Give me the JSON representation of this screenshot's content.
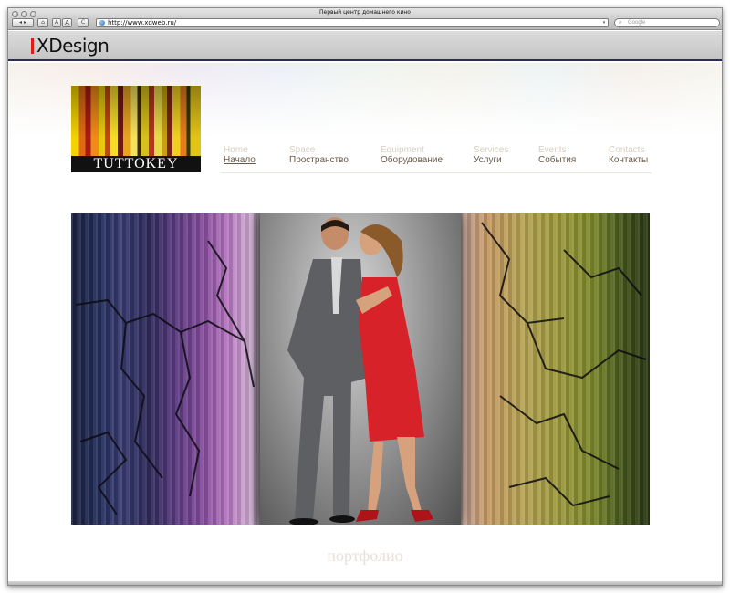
{
  "window": {
    "title": "Первый центр домашнего кино",
    "url": "http://www.xdweb.ru/",
    "search_placeholder": "Google",
    "nav": {
      "back_label": "◂ ▸",
      "home_label": "⌂",
      "text_smaller_label": "A",
      "text_larger_label": "A",
      "reload_label": "C"
    }
  },
  "brand": {
    "name": "XDesign"
  },
  "site": {
    "logo_text": "TUTTOKEY",
    "menu": [
      {
        "en": "Home",
        "ru": "Начало"
      },
      {
        "en": "Space",
        "ru": "Пространство"
      },
      {
        "en": "Equipment",
        "ru": "Оборудование"
      },
      {
        "en": "Services",
        "ru": "Услуги"
      },
      {
        "en": "Events",
        "ru": "События"
      },
      {
        "en": "Contacts",
        "ru": "Контакты"
      }
    ],
    "caption": "портфолио"
  },
  "colors": {
    "brand_accent": "#e11a1a",
    "menu_text": "#6a5a4a",
    "menu_sub_text": "#d8cfc2",
    "dress": "#d8222a"
  }
}
